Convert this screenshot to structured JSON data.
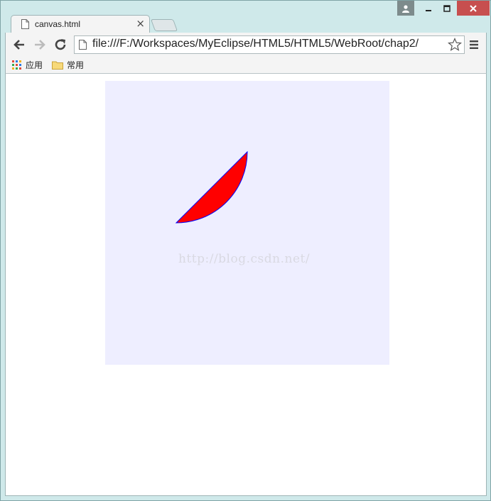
{
  "window": {
    "buttons": {
      "user": "user-icon",
      "minimize": "minimize-icon",
      "maximize": "maximize-icon",
      "close": "close-icon"
    }
  },
  "tab": {
    "title": "canvas.html",
    "close_label": "×"
  },
  "toolbar": {
    "url": "file:///F:/Workspaces/MyEclipse/HTML5/HTML5/WebRoot/chap2/"
  },
  "bookmarks": {
    "items": [
      {
        "label": "应用",
        "icon": "apps-grid-icon"
      },
      {
        "label": "常用",
        "icon": "folder-icon"
      }
    ]
  },
  "page": {
    "canvas_background": "#eeeeff",
    "shape_fill": "#ff0000",
    "shape_stroke": "#0000ff",
    "watermark": "http://blog.csdn.net/"
  }
}
